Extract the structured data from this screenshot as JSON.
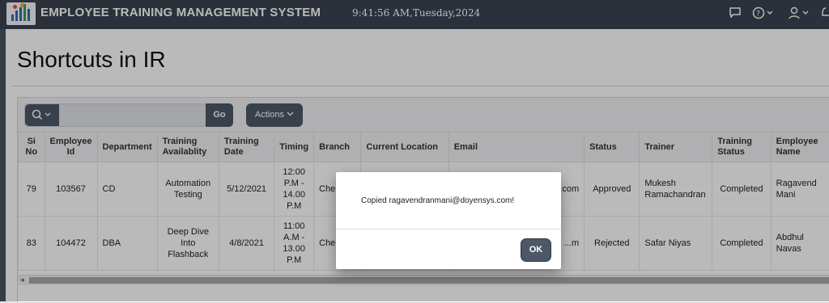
{
  "app": {
    "title": "EMPLOYEE TRAINING MANAGEMENT SYSTEM",
    "clock": "9:41:56 AM,Tuesday,2024",
    "icons": [
      "chat-icon",
      "help-icon",
      "user-icon",
      "bell-icon"
    ]
  },
  "page": {
    "title": "Shortcuts in IR"
  },
  "toolbar": {
    "go_label": "Go",
    "actions_label": "Actions",
    "search_value": ""
  },
  "table": {
    "headers": [
      "Si No",
      "Employee Id",
      "Department",
      "Training Availablity",
      "Training Date",
      "Timing",
      "Branch",
      "Current Location",
      "Email",
      "Status",
      "Trainer",
      "Training Status",
      "Employee Name"
    ],
    "rows": [
      [
        "79",
        "103567",
        "CD",
        "Automation Testing",
        "5/12/2021",
        "12:00 P.M - 14.00 P.M",
        "Che",
        "",
        "...ys.com",
        "Approved",
        "Mukesh Ramachandran",
        "Completed",
        "Ragavend Mani"
      ],
      [
        "83",
        "104472",
        "DBA",
        "Deep Dive Into Flashback",
        "4/8/2021",
        "11:00 A.M - 13.00 P.M",
        "Che",
        "",
        "...m",
        "Rejected",
        "Safar Niyas",
        "Completed",
        "Abdhul Navas"
      ]
    ]
  },
  "dialog": {
    "message": "Copied ragavendranmani@doyensys.com!",
    "ok_label": "OK"
  }
}
